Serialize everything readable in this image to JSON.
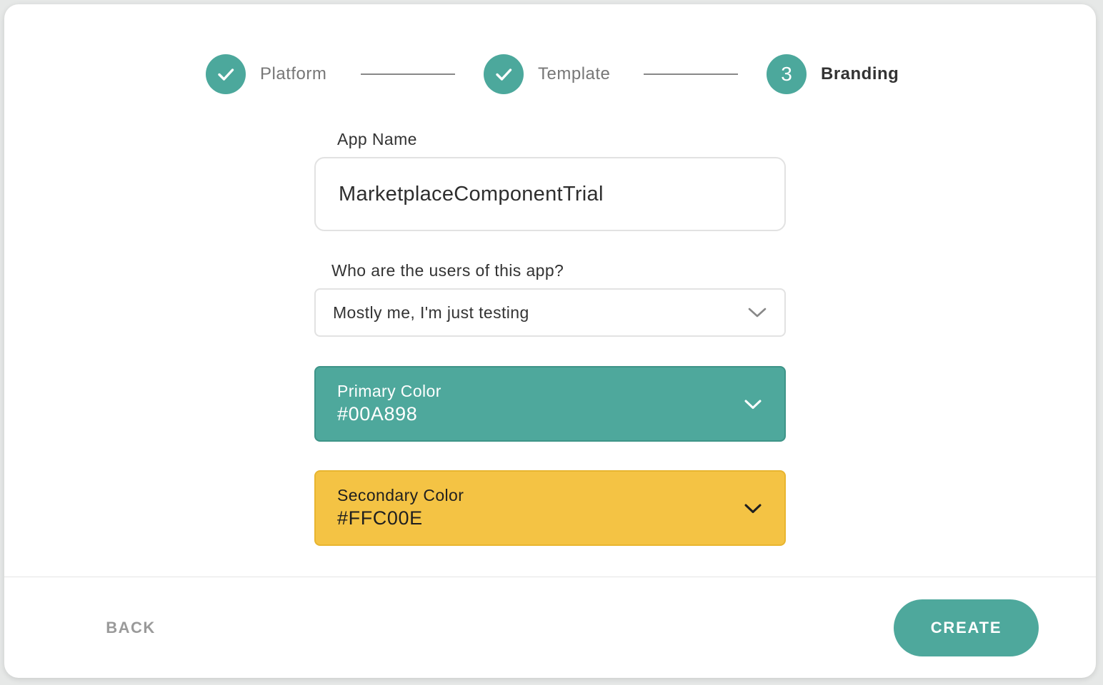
{
  "stepper": {
    "steps": [
      {
        "label": "Platform",
        "state": "completed",
        "icon": "check-icon"
      },
      {
        "label": "Template",
        "state": "completed",
        "icon": "check-icon"
      },
      {
        "label": "Branding",
        "state": "active",
        "number": "3"
      }
    ]
  },
  "form": {
    "app_name_label": "App Name",
    "app_name_value": "MarketplaceComponentTrial",
    "users_label": "Who are the users of this app?",
    "users_selected": "Mostly me, I'm just testing",
    "primary_color": {
      "label": "Primary Color",
      "value": "#00A898"
    },
    "secondary_color": {
      "label": "Secondary Color",
      "value": "#FFC00E"
    }
  },
  "footer": {
    "back_label": "BACK",
    "create_label": "CREATE"
  },
  "colors": {
    "accent": "#4EA89C",
    "secondary_swatch": "#F4C344"
  }
}
